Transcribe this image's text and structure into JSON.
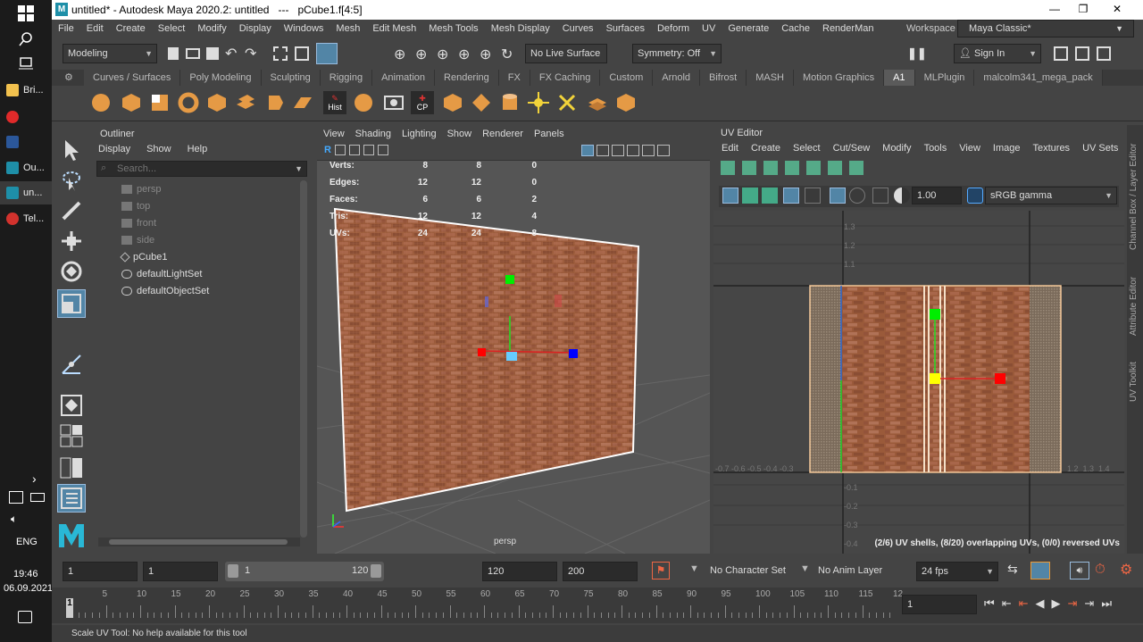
{
  "taskbar": {
    "items": [
      {
        "label": "Bri...",
        "icon": "folder-icon",
        "color": "#f2c14e"
      },
      {
        "label": "",
        "icon": "yandex-icon",
        "color": "#e02a2a"
      },
      {
        "label": "",
        "icon": "word-icon",
        "color": "#2b579a"
      },
      {
        "label": "Ou...",
        "icon": "maya-icon",
        "color": "#1e8fa8"
      },
      {
        "label": "un...",
        "icon": "maya-icon",
        "color": "#1e8fa8"
      },
      {
        "label": "Tel...",
        "icon": "app-icon",
        "color": "#d2322d"
      }
    ],
    "lang": "ENG",
    "time": "19:46",
    "date": "06.09.2021"
  },
  "window": {
    "title": "untitled* - Autodesk Maya 2020.2: untitled   ---   pCube1.f[4:5]"
  },
  "menubar": [
    "File",
    "Edit",
    "Create",
    "Select",
    "Modify",
    "Display",
    "Windows",
    "Mesh",
    "Edit Mesh",
    "Mesh Tools",
    "Mesh Display",
    "Curves",
    "Surfaces",
    "Deform",
    "UV",
    "Generate",
    "Cache",
    "RenderMan"
  ],
  "workspace": {
    "label": "Workspace :",
    "value": "Maya Classic*"
  },
  "statusline": {
    "mode": "Modeling",
    "live_surface": "No Live Surface",
    "symmetry": "Symmetry: Off",
    "sign_in": "Sign In"
  },
  "shelf_tabs": [
    "Curves / Surfaces",
    "Poly Modeling",
    "Sculpting",
    "Rigging",
    "Animation",
    "Rendering",
    "FX",
    "FX Caching",
    "Custom",
    "Arnold",
    "Bifrost",
    "MASH",
    "Motion Graphics",
    "A1",
    "MLPlugin",
    "malcolm341_mega_pack"
  ],
  "shelf_active": "A1",
  "shelf_labels": {
    "hist": "Hist",
    "cp": "CP"
  },
  "outliner": {
    "title": "Outliner",
    "menu": [
      "Display",
      "Show",
      "Help"
    ],
    "search_placeholder": "Search...",
    "items": [
      {
        "label": "persp",
        "dim": true
      },
      {
        "label": "top",
        "dim": true
      },
      {
        "label": "front",
        "dim": true
      },
      {
        "label": "side",
        "dim": true
      },
      {
        "label": "pCube1",
        "dim": false
      },
      {
        "label": "defaultLightSet",
        "dim": false
      },
      {
        "label": "defaultObjectSet",
        "dim": false
      }
    ]
  },
  "viewport": {
    "menu": [
      "View",
      "Shading",
      "Lighting",
      "Show",
      "Renderer",
      "Panels"
    ],
    "camera": "persp",
    "hud": [
      {
        "label": "Verts:",
        "a": "8",
        "b": "8",
        "c": "0"
      },
      {
        "label": "Edges:",
        "a": "12",
        "b": "12",
        "c": "0"
      },
      {
        "label": "Faces:",
        "a": "6",
        "b": "6",
        "c": "2"
      },
      {
        "label": "Tris:",
        "a": "12",
        "b": "12",
        "c": "4"
      },
      {
        "label": "UVs:",
        "a": "24",
        "b": "24",
        "c": "8"
      }
    ]
  },
  "uv_editor": {
    "title": "UV Editor",
    "menu": [
      "Edit",
      "Create",
      "Select",
      "Cut/Sew",
      "Modify",
      "Tools",
      "View",
      "Image",
      "Textures",
      "UV Sets"
    ],
    "exposure": "1.00",
    "color_space": "sRGB gamma",
    "status": "(2/6) UV shells, (8/20) overlapping UVs, (0/0) reversed UVs",
    "y_ticks_top": [
      "1.3",
      "1.2",
      "1.1"
    ],
    "y_ticks_bottom": [
      "-0.1",
      "-0.2",
      "-0.3",
      "-0.4"
    ],
    "x_ticks_left": "-0.7 -0.6 -0.5 -0.4 -0.3",
    "x_ticks_right": "1.2  1.3  1.4"
  },
  "right_tabs": [
    "Channel Box / Layer Editor",
    "Attribute Editor",
    "UV Toolkit"
  ],
  "timebar": {
    "start": "1",
    "current": "1",
    "range_start": "1",
    "range_end": "120",
    "end": "120",
    "max": "200",
    "character_set": "No Character Set",
    "anim_layer": "No Anim Layer",
    "fps": "24 fps"
  },
  "timeline": {
    "ticks": [
      "5",
      "10",
      "15",
      "20",
      "25",
      "30",
      "35",
      "40",
      "45",
      "50",
      "55",
      "60",
      "65",
      "70",
      "75",
      "80",
      "85",
      "90",
      "95",
      "100",
      "105",
      "110",
      "115",
      "12"
    ],
    "current_frame": "1",
    "first_label": "1"
  },
  "helpline": "Scale UV Tool: No help available for this tool"
}
